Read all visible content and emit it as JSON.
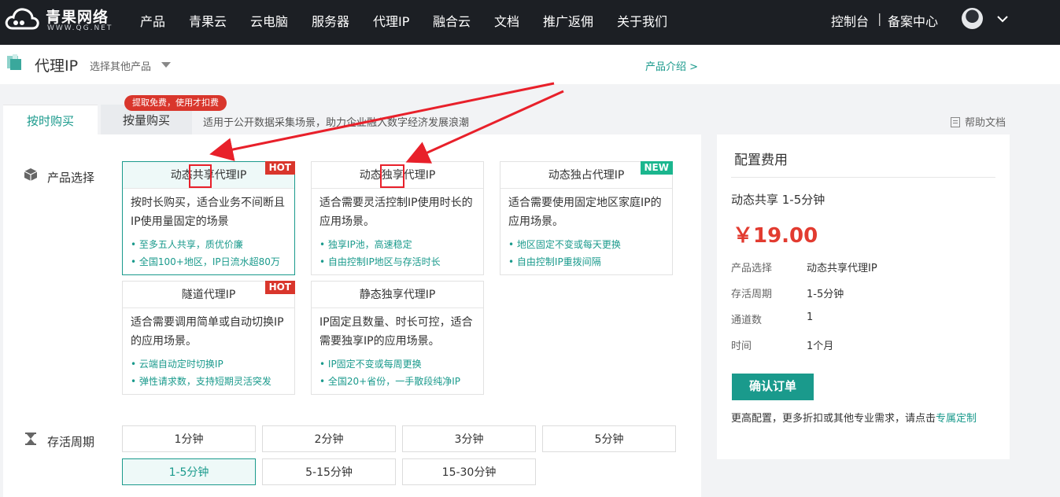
{
  "topnav": {
    "logo_title": "青果网络",
    "logo_sub": "WWW.QG.NET",
    "items": [
      "产品",
      "青果云",
      "云电脑",
      "服务器",
      "代理IP",
      "融合云",
      "文档",
      "推广返佣",
      "关于我们"
    ],
    "console": "控制台",
    "separator": "|",
    "filing": "备案中心"
  },
  "subhead": {
    "title": "代理IP",
    "select": "选择其他产品",
    "intro": "产品介绍 >"
  },
  "tabs": {
    "hourly": "按时购买",
    "volume": "按量购买",
    "badge": "提取免费，使用才扣费",
    "description": "适用于公开数据采集场景，助力企业融入数字经济发展浪潮",
    "help": "帮助文档"
  },
  "product": {
    "label": "产品选择",
    "cards": [
      {
        "title": "动态共享代理IP",
        "tag": "HOT",
        "body": "按时长购买，适合业务不间断且IP使用量固定的场景",
        "features": [
          "至多五人共享，质优价廉",
          "全国100+地区，IP日流水超80万"
        ]
      },
      {
        "title": "动态独享代理IP",
        "tag": "",
        "body": "适合需要灵活控制IP使用时长的应用场景。",
        "features": [
          "独享IP池，高速稳定",
          "自由控制IP地区与存活时长"
        ]
      },
      {
        "title": "动态独占代理IP",
        "tag": "NEW",
        "body": "适合需要使用固定地区家庭IP的应用场景。",
        "features": [
          "地区固定不变或每天更换",
          "自由控制IP重拨间隔"
        ]
      },
      {
        "title": "隧道代理IP",
        "tag": "HOT",
        "body": "适合需要调用简单或自动切换IP的应用场景。",
        "features": [
          "云端自动定时切换IP",
          "弹性请求数，支持短期灵活突发"
        ]
      },
      {
        "title": "静态独享代理IP",
        "tag": "",
        "body": "IP固定且数量、时长可控，适合需要独享IP的应用场景。",
        "features": [
          "IP固定不变或每周更换",
          "全国20+省份，一手散段纯净IP"
        ]
      }
    ]
  },
  "period": {
    "label": "存活周期",
    "options": [
      "1分钟",
      "2分钟",
      "3分钟",
      "5分钟",
      "1-5分钟",
      "5-15分钟",
      "15-30分钟"
    ]
  },
  "config": {
    "title": "配置费用",
    "product_line": "动态共享  1-5分钟",
    "price": "￥19.00",
    "specs": [
      {
        "k": "产品选择",
        "v": "动态共享代理IP"
      },
      {
        "k": "存活周期",
        "v": "1-5分钟"
      },
      {
        "k": "通道数",
        "v": "1"
      },
      {
        "k": "时间",
        "v": "1个月"
      }
    ],
    "confirm": "确认订单",
    "note": "更高配置，更多折扣或其他专业需求，请点击",
    "note_link": "专属定制"
  },
  "colors": {
    "accent": "#1a9a8c",
    "price": "#e23b30",
    "hot": "#d9362c",
    "new": "#1bb68e",
    "nav_bg": "#1c1f24"
  }
}
